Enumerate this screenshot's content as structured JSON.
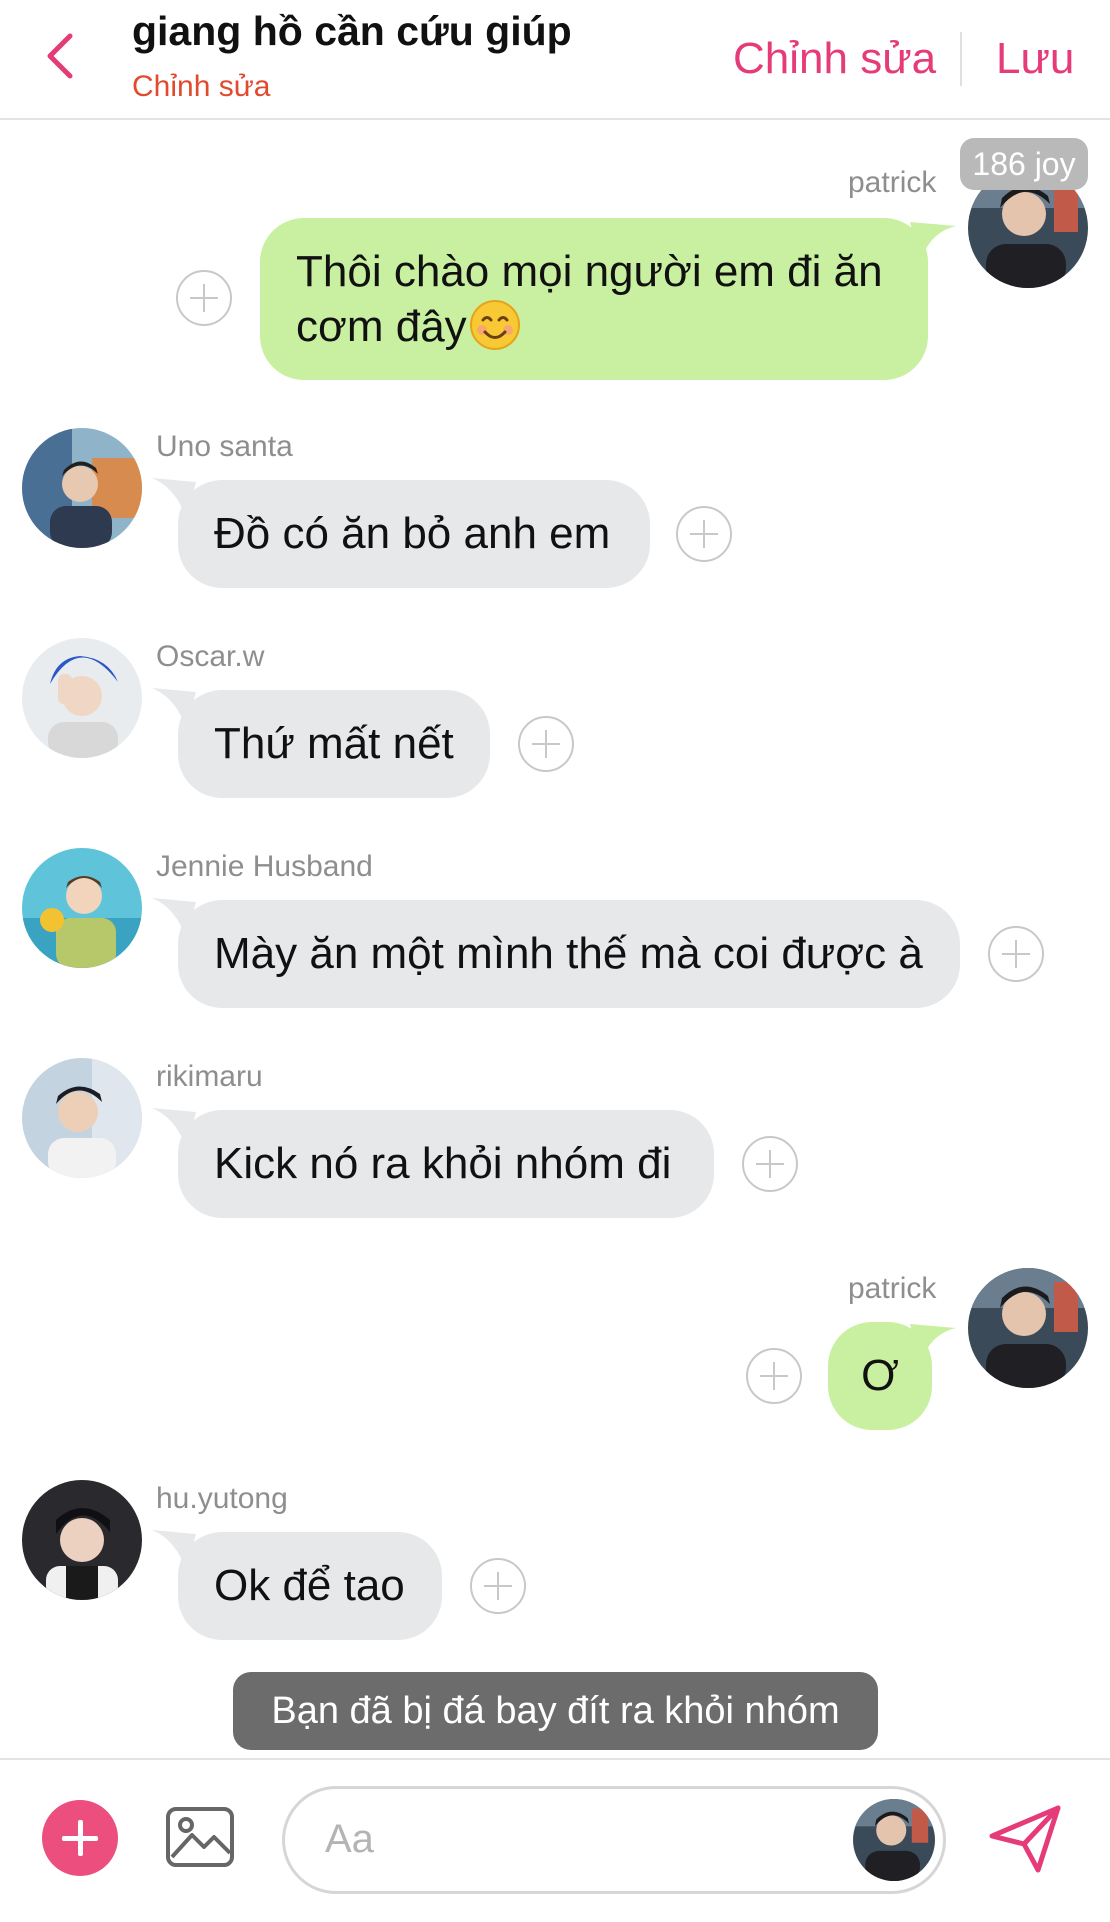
{
  "header": {
    "title": "giang hồ cần cứu giúp",
    "subtitle": "Chỉnh sửa",
    "edit_label": "Chỉnh sửa",
    "save_label": "Lưu",
    "accent_color": "#e63b79",
    "subtitle_color": "#e24a2f"
  },
  "badge": {
    "text": "186 joy"
  },
  "messages": [
    {
      "sender": "patrick",
      "side": "right",
      "text_line1": "Thôi chào mọi người em đi ăn",
      "text_line2": "cơm đây",
      "emoji": "smiling-face-emoji"
    },
    {
      "sender": "Uno santa",
      "side": "left",
      "text": "Đồ có ăn bỏ anh em"
    },
    {
      "sender": "Oscar.w",
      "side": "left",
      "text": "Thứ mất nết"
    },
    {
      "sender": "Jennie Husband",
      "side": "left",
      "text": "Mày ăn một mình thế mà coi được à"
    },
    {
      "sender": "rikimaru",
      "side": "left",
      "text": "Kick nó ra khỏi nhóm đi"
    },
    {
      "sender": "patrick",
      "side": "right",
      "text": "Ơ"
    },
    {
      "sender": "hu.yutong",
      "side": "left",
      "text": "Ok để tao"
    }
  ],
  "system_message": "Bạn đã bị đá bay đít ra khỏi nhóm",
  "composer": {
    "placeholder": "Aa"
  },
  "colors": {
    "my_bubble": "#c9f0a0",
    "other_bubble": "#e7e8ea",
    "add_button": "#ec4e7e",
    "send_icon": "#e63b79"
  }
}
